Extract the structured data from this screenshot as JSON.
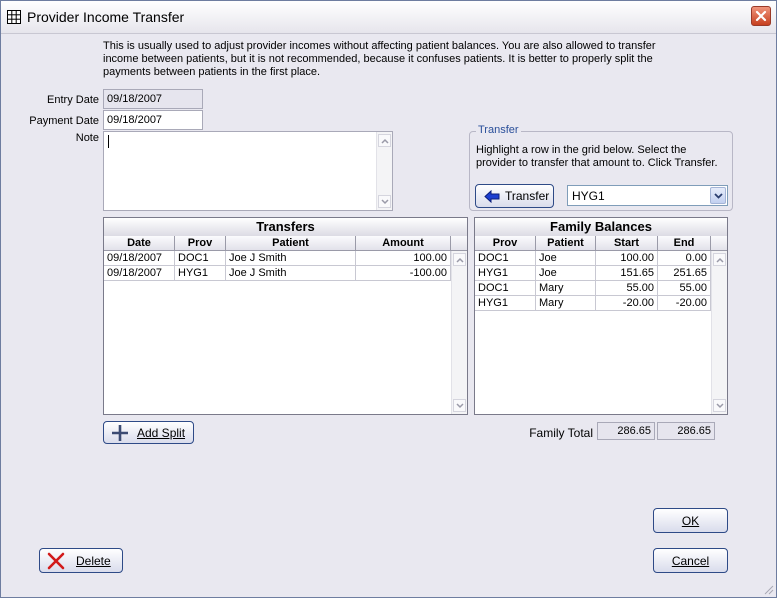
{
  "window": {
    "title": "Provider Income Transfer"
  },
  "intro_text": "This is usually used to adjust provider incomes without affecting patient balances.  You are also allowed to transfer income between patients, but it is not recommended, because it confuses patients.  It is better to properly split the payments between patients in the first place.",
  "form": {
    "entry_date_label": "Entry Date",
    "entry_date_value": "09/18/2007",
    "payment_date_label": "Payment Date",
    "payment_date_value": "09/18/2007",
    "note_label": "Note",
    "note_value": ""
  },
  "transfer_group": {
    "legend": "Transfer",
    "help": "Highlight a row in the grid below.  Select the provider to transfer that amount to.  Click Transfer.",
    "button_label": "Transfer",
    "provider_selected": "HYG1"
  },
  "transfers_grid": {
    "title": "Transfers",
    "columns": [
      "Date",
      "Prov",
      "Patient",
      "Amount"
    ],
    "rows": [
      [
        "09/18/2007",
        "DOC1",
        "Joe J Smith",
        "100.00"
      ],
      [
        "09/18/2007",
        "HYG1",
        "Joe J Smith",
        "-100.00"
      ]
    ]
  },
  "family_grid": {
    "title": "Family Balances",
    "columns": [
      "Prov",
      "Patient",
      "Start",
      "End"
    ],
    "rows": [
      [
        "DOC1",
        "Joe",
        "100.00",
        "0.00"
      ],
      [
        "HYG1",
        "Joe",
        "151.65",
        "251.65"
      ],
      [
        "DOC1",
        "Mary",
        "55.00",
        "55.00"
      ],
      [
        "HYG1",
        "Mary",
        "-20.00",
        "-20.00"
      ]
    ]
  },
  "family_total": {
    "label": "Family Total",
    "start": "286.65",
    "end": "286.65"
  },
  "buttons": {
    "add_split": "Add Split",
    "ok": "OK",
    "cancel": "Cancel",
    "delete": "Delete"
  }
}
